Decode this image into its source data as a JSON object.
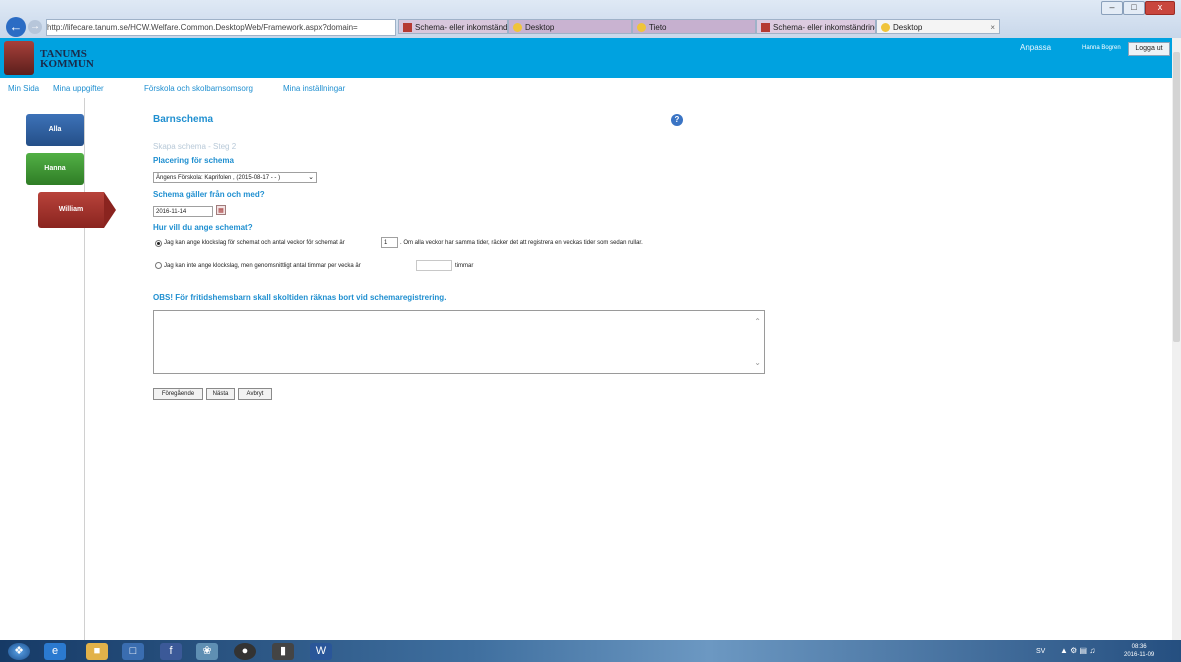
{
  "browser": {
    "window_buttons": [
      "–",
      "□",
      "x"
    ],
    "url": "http://lifecare.tanum.se/HCW.Welfare.Common.DesktopWeb/Framework.aspx?domain=",
    "tabs": [
      {
        "label": "Schema- eller inkomständring ..."
      },
      {
        "label": "Desktop"
      },
      {
        "label": "Tieto"
      },
      {
        "label": "Schema- eller inkomständring ..."
      },
      {
        "label": "Desktop"
      }
    ]
  },
  "header": {
    "municipality_line1": "TANUMS",
    "municipality_line2": "KOMMUN",
    "customize": "Anpassa",
    "user": "Hanna Bogren",
    "logout": "Logga ut"
  },
  "menu": [
    "Min Sida",
    "Mina uppgifter",
    "Förskola och skolbarnsomsorg",
    "Mina inställningar"
  ],
  "sidebar": {
    "children": [
      {
        "name": "Alla",
        "color": "#2e5e9e"
      },
      {
        "name": "Hanna",
        "color": "#3f9a32"
      },
      {
        "name": "William",
        "color": "#a8322c"
      }
    ]
  },
  "form": {
    "title": "Barnschema",
    "step": "Skapa schema - Steg 2",
    "placement_label": "Placering för schema",
    "placement_value": "Ängens Förskola: Kaprifolen , (2015-08-17 - - )",
    "valid_from_label": "Schema gäller från och med?",
    "valid_from_value": "2016-11-14",
    "how_label": "Hur vill du ange schemat?",
    "option1_text_a": "Jag kan ange klockslag för schemat och antal veckor för schemat är",
    "option1_weeks": "1",
    "option1_text_b": ". Om alla veckor har samma tider, räcker det att registrera en veckas tider som sedan rullar.",
    "option2_text_a": "Jag kan inte ange klockslag, men genomsnittligt antal timmar per vecka är",
    "option2_text_b": "timmar",
    "notice": "OBS! För fritidshemsbarn skall skoltiden räknas bort vid schemaregistrering.",
    "buttons": {
      "previous": "Föregående",
      "next": "Nästa",
      "cancel": "Avbryt"
    }
  },
  "taskbar": {
    "language": "SV",
    "time": "08:36",
    "date": "2016-11-09"
  },
  "colors": {
    "brand": "#00a2e0",
    "accent_text": "#1f8fd0"
  }
}
